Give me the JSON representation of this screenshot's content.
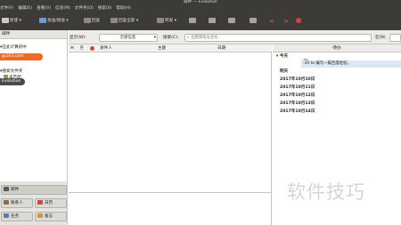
{
  "window": {
    "title": "邮件 — Evolution"
  },
  "menu": [
    "文件(F)",
    "编辑(E)",
    "查看(V)",
    "信息(M)",
    "文件夹(O)",
    "搜索(S)",
    "帮助(H)"
  ],
  "toolbar": {
    "new_label": "新建",
    "send_receive_label": "发送/接收",
    "reply_label": "回复",
    "reply_all_label": "回复全部",
    "forward_label": "转发"
  },
  "sidebar": {
    "header": "邮件",
    "on_this_computer": "在此计算机中",
    "account": "@163.com",
    "search_folders": "搜索文件夹",
    "unmatched": "未匹配",
    "evolution": "Evolution"
  },
  "searchbar": {
    "show_label": "显示(W):",
    "show_value": "全部信息",
    "search_label": "搜索(C):",
    "search_placeholder": "主题或地址含有",
    "scope_label": "在(N)"
  },
  "columns": {
    "from": "发件人",
    "subject": "主题",
    "date": "日期"
  },
  "switcher": {
    "mail": "邮件",
    "contacts": "联系人",
    "calendar": "日历",
    "tasks": "任务",
    "memos": "备忘"
  },
  "todo": {
    "header": "待办",
    "today": "今天",
    "task_text": "-34 to 编写一篇百度经验。",
    "tomorrow": "明天",
    "dates": [
      "2017年10月10日",
      "2017年10月11日",
      "2017年10月12日",
      "2017年10月13日",
      "2017年10月14日"
    ]
  },
  "watermark": "软件技巧",
  "colors": {
    "toolbar_bg": "#3c3b37",
    "accent": "#ee6b27"
  }
}
